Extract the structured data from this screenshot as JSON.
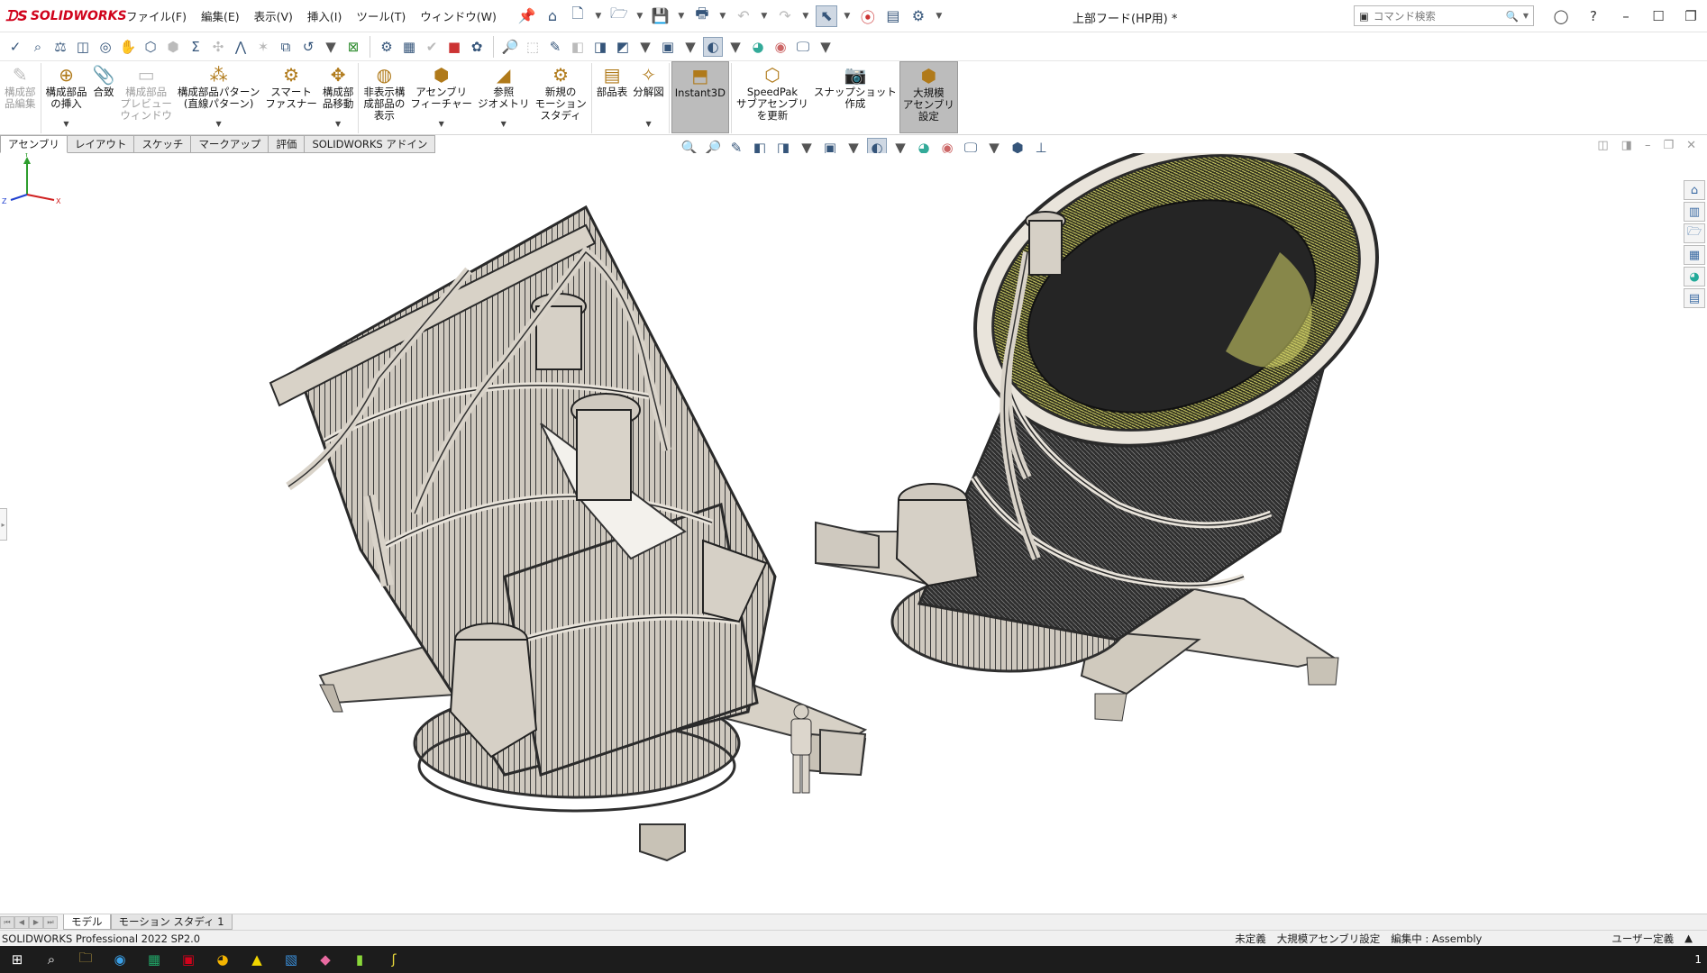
{
  "app": {
    "brand": "SOLIDWORKS",
    "doc_title": "上部フード(HP用) *"
  },
  "menu": [
    "ファイル(F)",
    "編集(E)",
    "表示(V)",
    "挿入(I)",
    "ツール(T)",
    "ウィンドウ(W)"
  ],
  "search": {
    "placeholder": "コマンド検索"
  },
  "ribbon": [
    {
      "label": "構成部\n品編集",
      "icon": "edit-component-icon",
      "disabled": true
    },
    {
      "label": "構成部品\nの挿入",
      "icon": "insert-component-icon",
      "dropdown": true
    },
    {
      "label": "合致",
      "icon": "mate-icon"
    },
    {
      "label": "構成部品\nプレビュー\nウィンドウ",
      "icon": "component-preview-icon",
      "disabled": true
    },
    {
      "label": "構成部品パターン\n(直線パターン)",
      "icon": "linear-pattern-icon",
      "dropdown": true
    },
    {
      "label": "スマート\nファスナー",
      "icon": "smart-fastener-icon"
    },
    {
      "label": "構成部\n品移動",
      "icon": "move-component-icon",
      "dropdown": true
    },
    {
      "label": "非表示構\n成部品の\n表示",
      "icon": "show-hidden-icon"
    },
    {
      "label": "アセンブリ\nフィーチャー",
      "icon": "assembly-feature-icon",
      "dropdown": true
    },
    {
      "label": "参照\nジオメトリ",
      "icon": "reference-geometry-icon",
      "dropdown": true
    },
    {
      "label": "新規の\nモーション\nスタディ",
      "icon": "motion-study-icon"
    },
    {
      "label": "部品表",
      "icon": "bom-icon"
    },
    {
      "label": "分解図",
      "icon": "exploded-view-icon",
      "dropdown": true
    },
    {
      "label": "Instant3D",
      "icon": "instant3d-icon",
      "active": true
    },
    {
      "label": "SpeedPak\nサブアセンブリ\nを更新",
      "icon": "speedpak-icon"
    },
    {
      "label": "スナップショット\n作成",
      "icon": "snapshot-icon"
    },
    {
      "label": "大規模\nアセンブリ\n設定",
      "icon": "large-assembly-icon",
      "active": true
    }
  ],
  "tabs": [
    "アセンブリ",
    "レイアウト",
    "スケッチ",
    "マークアップ",
    "評価",
    "SOLIDWORKS アドイン"
  ],
  "bottom_tabs": [
    "モデル",
    "モーション スタディ 1"
  ],
  "status": {
    "left": "SOLIDWORKS Professional 2022 SP2.0",
    "undefined": "未定義",
    "large_asm": "大規模アセンブリ設定",
    "editing": "編集中 : Assembly",
    "units": "ユーザー定義"
  },
  "triad": {
    "x": "X",
    "y": "Y",
    "z": "Z"
  },
  "colors": {
    "accent": "#d0021b",
    "steel": "#d6d0c6",
    "dark": "#2a2a2a",
    "yellow": "#d9d96a"
  }
}
